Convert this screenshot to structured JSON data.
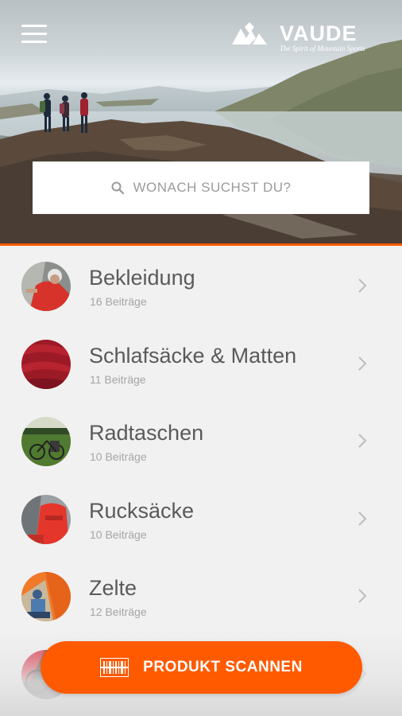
{
  "header": {
    "menu_icon": "hamburger-menu-icon",
    "brand": "VAUDE",
    "tagline": "The Spirit of Mountain Sports"
  },
  "search": {
    "icon": "search-icon",
    "placeholder": "WONACH SUCHST DU?"
  },
  "categories": [
    {
      "title": "Bekleidung",
      "count": "16 Beiträge"
    },
    {
      "title": "Schlafsäcke & Matten",
      "count": "11 Beiträge"
    },
    {
      "title": "Radtaschen",
      "count": "10 Beiträge"
    },
    {
      "title": "Rucksäcke",
      "count": "10 Beiträge"
    },
    {
      "title": "Zelte",
      "count": "12 Beiträge"
    },
    {
      "title": "",
      "count": ""
    }
  ],
  "scan_button": {
    "icon": "barcode-icon",
    "label": "PRODUKT SCANNEN"
  },
  "colors": {
    "accent": "#ff5a00",
    "background": "#f1f1f1",
    "title_text": "#5a5a5a",
    "subtitle_text": "#a5a5a5"
  }
}
